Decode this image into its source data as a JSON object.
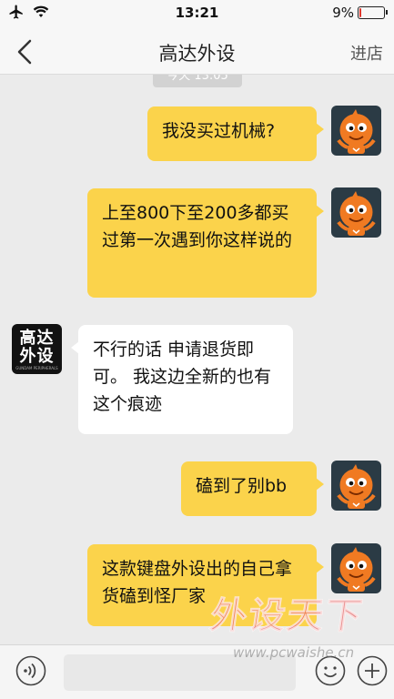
{
  "status_bar": {
    "time": "13:21",
    "battery_percent": "9%",
    "battery_level": 0.09,
    "icons": [
      "airplane-icon",
      "wifi-icon",
      "battery-icon"
    ]
  },
  "nav": {
    "title": "高达外设",
    "action": "进店",
    "back_icon": "chevron-left-icon"
  },
  "timestamp": "今天 13:05",
  "messages": [
    {
      "from": "me",
      "text": "我没买过机械?"
    },
    {
      "from": "me",
      "text": "上至800下至200多都买过第一次遇到你这样说的"
    },
    {
      "from": "shop",
      "text": "不行的话 申请退货即可。 我这边全新的也有这个痕迹"
    },
    {
      "from": "me",
      "text": "磕到了别bb"
    },
    {
      "from": "me",
      "text": "这款键盘外设出的自己拿货磕到怪厂家"
    }
  ],
  "shop_avatar": {
    "line1": "高达",
    "line2": "外设",
    "line3": "GUNDAM PERIPHERALS"
  },
  "input_bar": {
    "placeholder": "",
    "icons": [
      "voice-icon",
      "emoji-icon",
      "plus-icon"
    ]
  },
  "watermark": {
    "text": "外设天下",
    "url": "www.pcwaishe.cn"
  },
  "colors": {
    "my_bubble": "#fbd34b",
    "their_bubble": "#ffffff",
    "background": "#ebebeb",
    "battery_low": "#e0362c"
  }
}
